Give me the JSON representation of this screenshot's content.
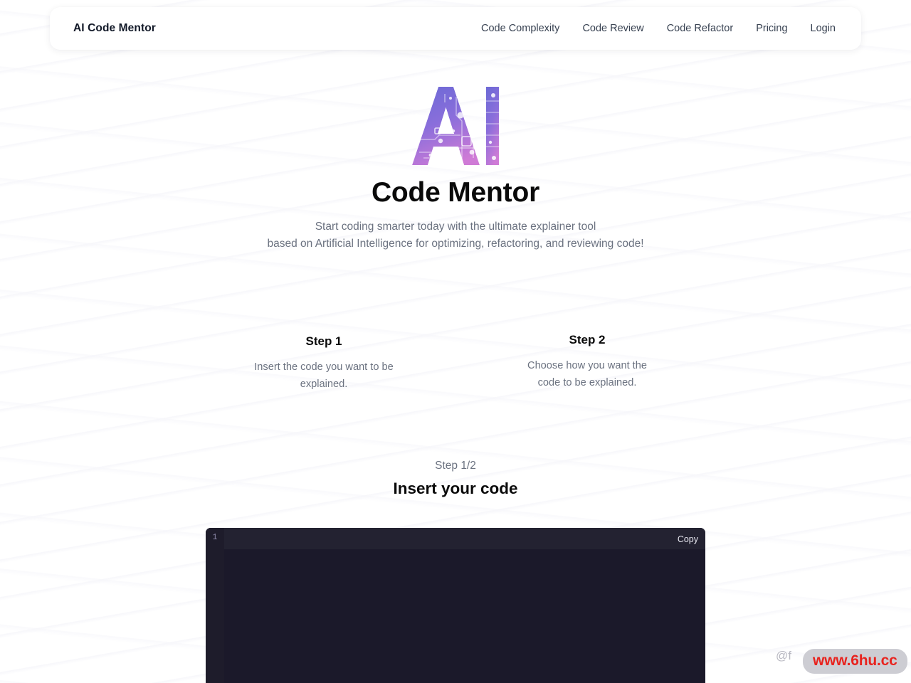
{
  "header": {
    "brand": "AI Code Mentor",
    "nav": [
      {
        "label": "Code Complexity"
      },
      {
        "label": "Code Review"
      },
      {
        "label": "Code Refactor"
      },
      {
        "label": "Pricing"
      },
      {
        "label": "Login"
      }
    ]
  },
  "hero": {
    "logo_text": "AI",
    "logo_colors": {
      "start": "#6f6ad6",
      "mid": "#9a73dc",
      "end": "#cf7bd6"
    },
    "title": "Code Mentor",
    "subtitle_line1": "Start coding smarter today with the ultimate explainer tool",
    "subtitle_line2": "based on Artificial Intelligence for optimizing, refactoring, and reviewing code!"
  },
  "steps": [
    {
      "title": "Step 1",
      "desc_line1": "Insert the code you want to be",
      "desc_line2": "explained."
    },
    {
      "title": "Step 2",
      "desc_line1": "Choose how you want the",
      "desc_line2": "code to be explained."
    }
  ],
  "stage": {
    "counter": "Step 1/2",
    "title": "Insert your code"
  },
  "editor": {
    "line_number": "1",
    "copy_label": "Copy",
    "code_value": "",
    "code_placeholder": "",
    "background_color": "#1b192a",
    "topstrip_color": "#232231"
  },
  "watermark": {
    "handle": "@f",
    "url": "www.6hu.cc",
    "url_color": "#e8231e"
  }
}
